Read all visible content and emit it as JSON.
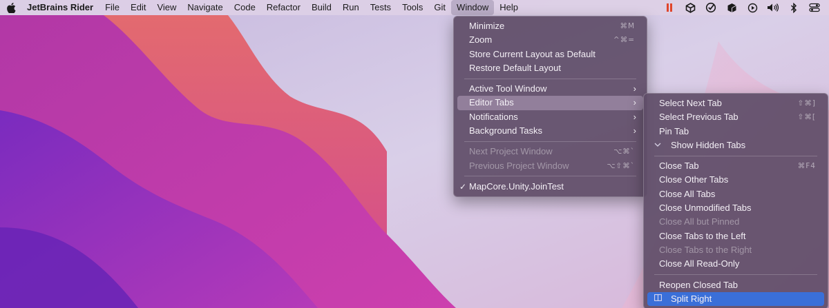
{
  "menubar": {
    "app_name": "JetBrains Rider",
    "items": [
      "File",
      "Edit",
      "View",
      "Navigate",
      "Code",
      "Refactor",
      "Build",
      "Run",
      "Tests",
      "Tools",
      "Git",
      "Window",
      "Help"
    ],
    "active_item": "Window",
    "status_icons": [
      "pause-bars-icon",
      "unity-icon",
      "check-dial-icon",
      "cube-icon",
      "play-circle-icon",
      "volume-icon",
      "bluetooth-icon",
      "control-center-icon"
    ]
  },
  "window_menu": {
    "minimize": "Minimize",
    "minimize_sc": "⌘M",
    "zoom": "Zoom",
    "zoom_sc": "^⌘=",
    "store_layout": "Store Current Layout as Default",
    "restore_layout": "Restore Default Layout",
    "active_tool_window": "Active Tool Window",
    "editor_tabs": "Editor Tabs",
    "notifications": "Notifications",
    "background_tasks": "Background Tasks",
    "next_project": "Next Project Window",
    "next_project_sc": "⌥⌘`",
    "prev_project": "Previous Project Window",
    "prev_project_sc": "⌥⇧⌘`",
    "current_project": "MapCore.Unity.JoinTest"
  },
  "editor_tabs_menu": {
    "select_next": "Select Next Tab",
    "select_next_sc": "⇧⌘]",
    "select_prev": "Select Previous Tab",
    "select_prev_sc": "⇧⌘[",
    "pin_tab": "Pin Tab",
    "show_hidden": "Show Hidden Tabs",
    "close_tab": "Close Tab",
    "close_tab_sc": "⌘F4",
    "close_others": "Close Other Tabs",
    "close_all": "Close All Tabs",
    "close_unmodified": "Close Unmodified Tabs",
    "close_but_pinned": "Close All but Pinned",
    "close_left": "Close Tabs to the Left",
    "close_right": "Close Tabs to the Right",
    "close_readonly": "Close All Read-Only",
    "reopen_closed": "Reopen Closed Tab",
    "split_right": "Split Right"
  },
  "colors": {
    "selection": "#3a6fd8",
    "pause_icon": "#e0452b"
  }
}
